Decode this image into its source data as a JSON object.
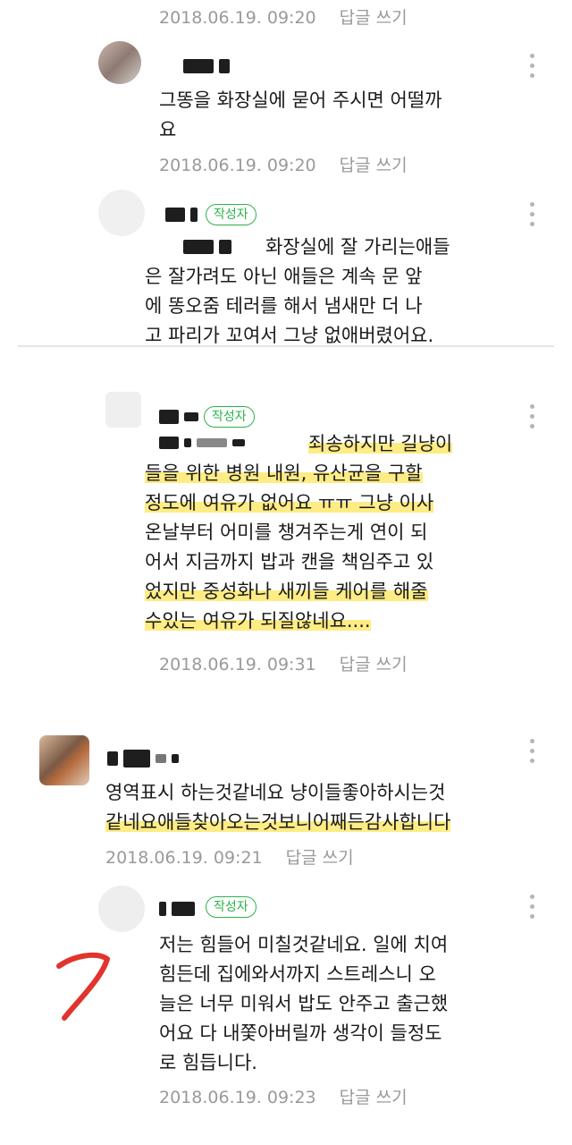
{
  "comments": [
    {
      "time": "2018.06.19. 09:20",
      "reply": "답글 쓰기"
    },
    {
      "lines": [
        "그똥을 화장실에 묻어 주시면 어떨까",
        "요"
      ],
      "time": "2018.06.19. 09:20",
      "reply": "답글 쓰기"
    },
    {
      "badge": "작성자",
      "lines": [
        "화장실에 잘 가리는애들",
        "은 잘가려도 아닌 애들은 계속 문 앞",
        "에 똥오줌 테러를 해서 냄새만 더 나",
        "고 파리가 꼬여서 그냥 없애버렸어요."
      ]
    },
    {
      "badge": "작성자",
      "lines": [
        "죄송하지만 길냥이",
        "들을 위한 병원 내원, 유산균을 구할",
        "정도에 여유가 없어요 ㅠㅠ 그냥 이사",
        "온날부터 어미를 챙겨주는게 연이 되",
        "어서 지금까지 밥과 캔을 책임주고 있",
        "었지만 중성화나 새끼들 케어를 해줄",
        "수있는 여유가 되질않네요...."
      ],
      "time": "2018.06.19. 09:31",
      "reply": "답글 쓰기"
    },
    {
      "lines": [
        "영역표시 하는것같네요 냥이들좋아하시는것",
        "같네요애들찾아오는것보니어째든감사합니다"
      ],
      "time": "2018.06.19. 09:21",
      "reply": "답글 쓰기"
    },
    {
      "badge": "작성자",
      "lines": [
        "저는 힘들어 미칠것같네요. 일에 치여",
        "힘든데 집에와서까지 스트레스니 오",
        "늘은 너무 미워서 밥도 안주고 출근했",
        "어요 다 내쫓아버릴까 생각이 들정도",
        "로 힘듭니다."
      ],
      "time": "2018.06.19. 09:23",
      "reply": "답글 쓰기"
    }
  ],
  "colors": {
    "badge": "#2bb34a",
    "meta": "#9a9a9a",
    "highlight": "#fde65a",
    "annotation": "#e0342c"
  }
}
